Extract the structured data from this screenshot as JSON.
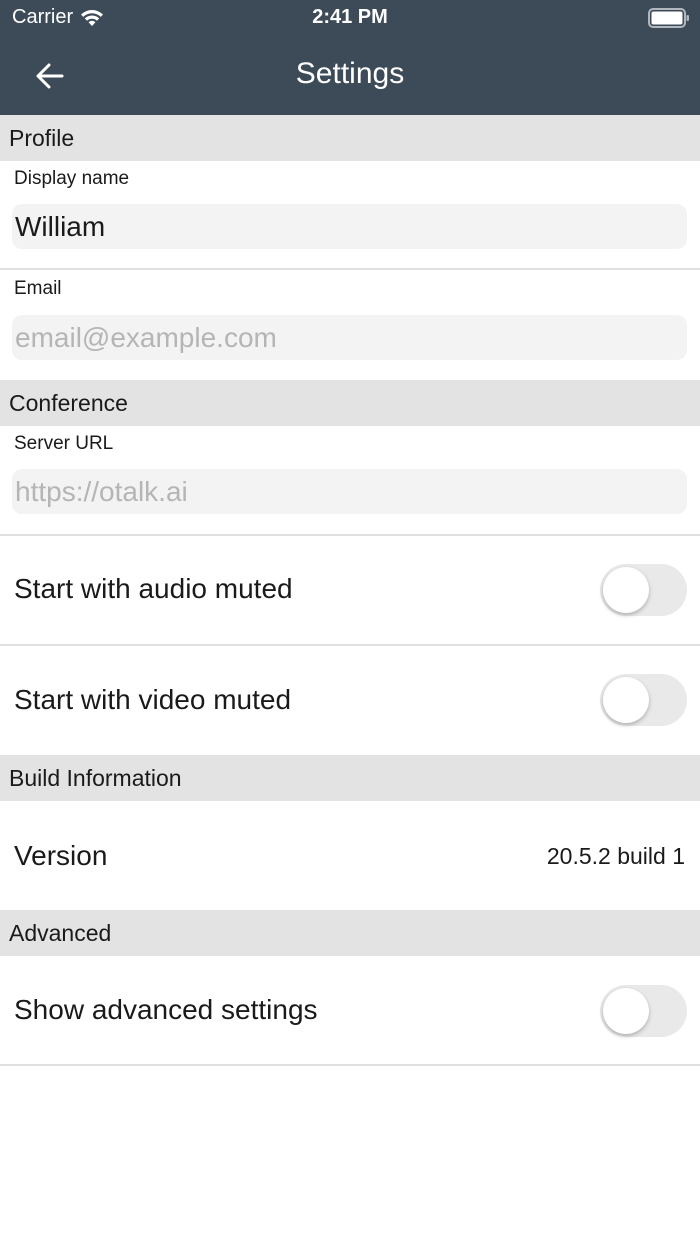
{
  "status_bar": {
    "carrier": "Carrier",
    "time": "2:41 PM"
  },
  "nav": {
    "title": "Settings",
    "back_icon": "arrow-left-icon"
  },
  "profile": {
    "header": "Profile",
    "display_name_label": "Display name",
    "display_name_value": "William",
    "email_label": "Email",
    "email_placeholder": "email@example.com"
  },
  "conference": {
    "header": "Conference",
    "server_url_label": "Server URL",
    "server_url_placeholder": "https://otalk.ai",
    "audio_muted_label": "Start with audio muted",
    "audio_muted": false,
    "video_muted_label": "Start with video muted",
    "video_muted": false
  },
  "build": {
    "header": "Build Information",
    "version_label": "Version",
    "version_value": "20.5.2 build 1"
  },
  "advanced": {
    "header": "Advanced",
    "show_advanced_label": "Show advanced settings",
    "show_advanced": false
  },
  "colors": {
    "nav_bar": "#3d4b59",
    "section_header": "#e3e3e3",
    "input_bg": "#f3f3f3",
    "toggle_off": "#e9e9ea"
  }
}
